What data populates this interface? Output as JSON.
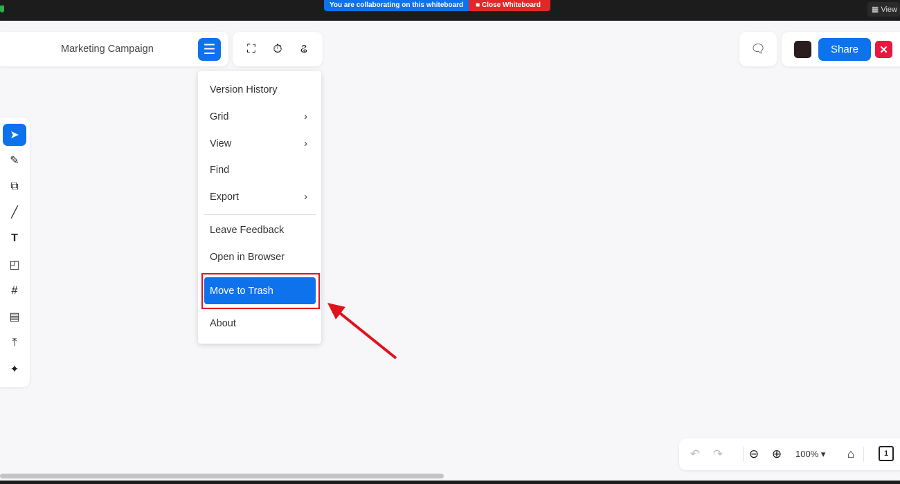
{
  "system_bar": {
    "collab_text": "You are collaborating on this whiteboard",
    "close_label": "Close Whiteboard",
    "view_label": "View"
  },
  "header": {
    "title": "Marketing Campaign",
    "share_label": "Share",
    "colors": {
      "accent": "#0e72ed",
      "close": "#e8173f"
    }
  },
  "menu": {
    "items": [
      {
        "label": "Version History",
        "arrow": ""
      },
      {
        "label": "Grid",
        "arrow": "›"
      },
      {
        "label": "View",
        "arrow": "›"
      },
      {
        "label": "Find",
        "arrow": ""
      },
      {
        "label": "Export",
        "arrow": "›"
      },
      {
        "label": "Leave Feedback",
        "arrow": ""
      },
      {
        "label": "Open in Browser",
        "arrow": ""
      },
      {
        "label": "Move to Trash",
        "arrow": ""
      },
      {
        "label": "About",
        "arrow": ""
      }
    ]
  },
  "tools": [
    "select-icon",
    "pen-icon",
    "shapes-icon",
    "line-icon",
    "text-icon",
    "sticky-note-icon",
    "frame-icon",
    "template-icon",
    "upload-icon",
    "more-tools-icon"
  ],
  "zoom": {
    "level": "100%",
    "pages": "1"
  }
}
